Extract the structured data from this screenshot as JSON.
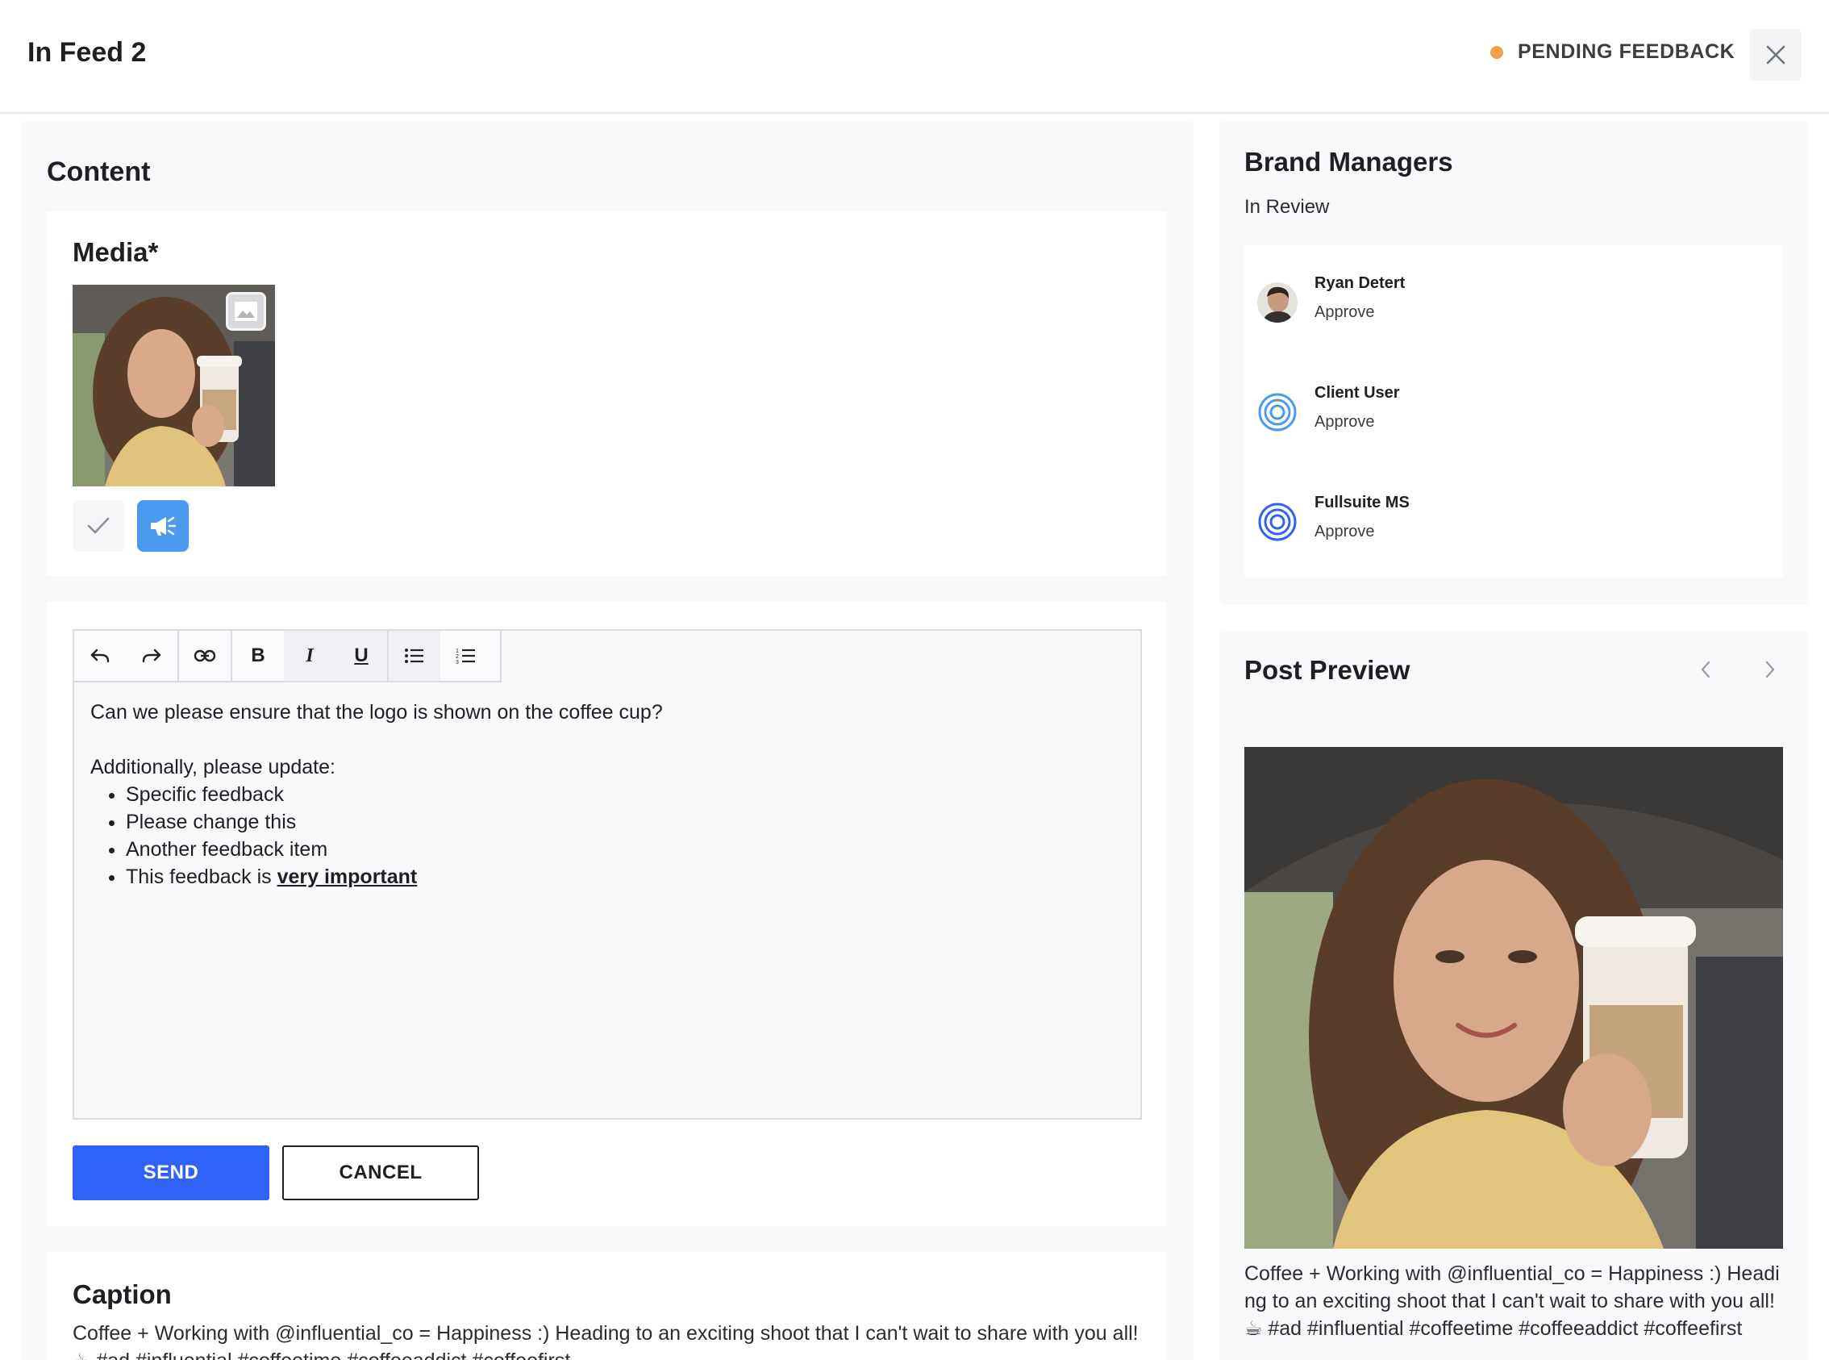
{
  "header": {
    "title": "In Feed 2",
    "status": "PENDING FEEDBACK",
    "status_color": "#f2a14c"
  },
  "content": {
    "heading": "Content",
    "media_label": "Media*",
    "editor": {
      "line1": "Can we please ensure that the logo is shown on the coffee cup?",
      "line2": "Additionally, please update:",
      "items": [
        "Specific feedback",
        "Please change this",
        "Another feedback item"
      ],
      "last_item_prefix": "This feedback is ",
      "last_item_emphasis": "very important",
      "toolbar": {
        "bold": "B",
        "italic": "I",
        "underline": "U"
      }
    },
    "send_label": "SEND",
    "cancel_label": "CANCEL",
    "caption_heading": "Caption",
    "caption_text": "Coffee + Working with @influential_co = Happiness :) Heading to an exciting shoot that I can't wait to share with you all! ☕ #ad #influential #coffeetime #coffeeaddict #coffeefirst"
  },
  "brand_managers": {
    "heading": "Brand Managers",
    "subheading": "In Review",
    "managers": [
      {
        "name": "Ryan Detert",
        "role": "Approve",
        "avatar": "photo-avatar"
      },
      {
        "name": "Client User",
        "role": "Approve",
        "avatar": "ring-avatar-light"
      },
      {
        "name": "Fullsuite MS",
        "role": "Approve",
        "avatar": "ring-avatar-dark"
      }
    ]
  },
  "post_preview": {
    "heading": "Post Preview",
    "caption": "Coffee + Working with @influential_co = Happiness :) Heading to an exciting shoot that I can't wait to share with you all! ☕ #ad #influential #coffeetime #coffeeaddict #coffeefirst"
  },
  "colors": {
    "primary": "#2f62f5",
    "promote": "#4a9bf0",
    "ring_light": "#4a9bf0",
    "ring_dark": "#2f62f5"
  }
}
